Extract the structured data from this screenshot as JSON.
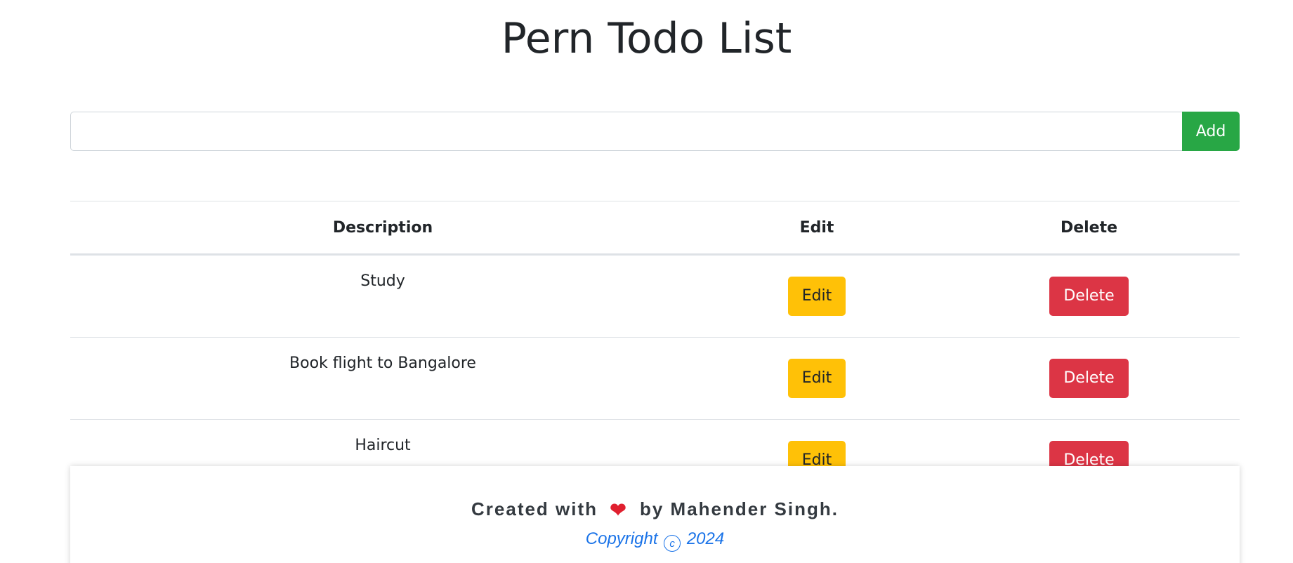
{
  "page": {
    "title": "Pern Todo List"
  },
  "input_form": {
    "value": "",
    "placeholder": "",
    "add_label": "Add"
  },
  "table": {
    "headers": [
      "Description",
      "Edit",
      "Delete"
    ],
    "rows": [
      {
        "description": "Study",
        "edit_label": "Edit",
        "delete_label": "Delete"
      },
      {
        "description": "Book flight to Bangalore",
        "edit_label": "Edit",
        "delete_label": "Delete"
      },
      {
        "description": "Haircut",
        "edit_label": "Edit",
        "delete_label": "Delete"
      }
    ]
  },
  "footer": {
    "credit_prefix": "Created with",
    "heart_icon": "heart-icon",
    "credit_suffix": "by Mahender Singh.",
    "copyright_prefix": "Copyright",
    "copyright_symbol": "c",
    "copyright_year": "2024"
  },
  "colors": {
    "add_button": "#28a745",
    "edit_button": "#ffc107",
    "delete_button": "#dc3545",
    "heart": "#e0202f",
    "copyright_text": "#1a73e8"
  }
}
